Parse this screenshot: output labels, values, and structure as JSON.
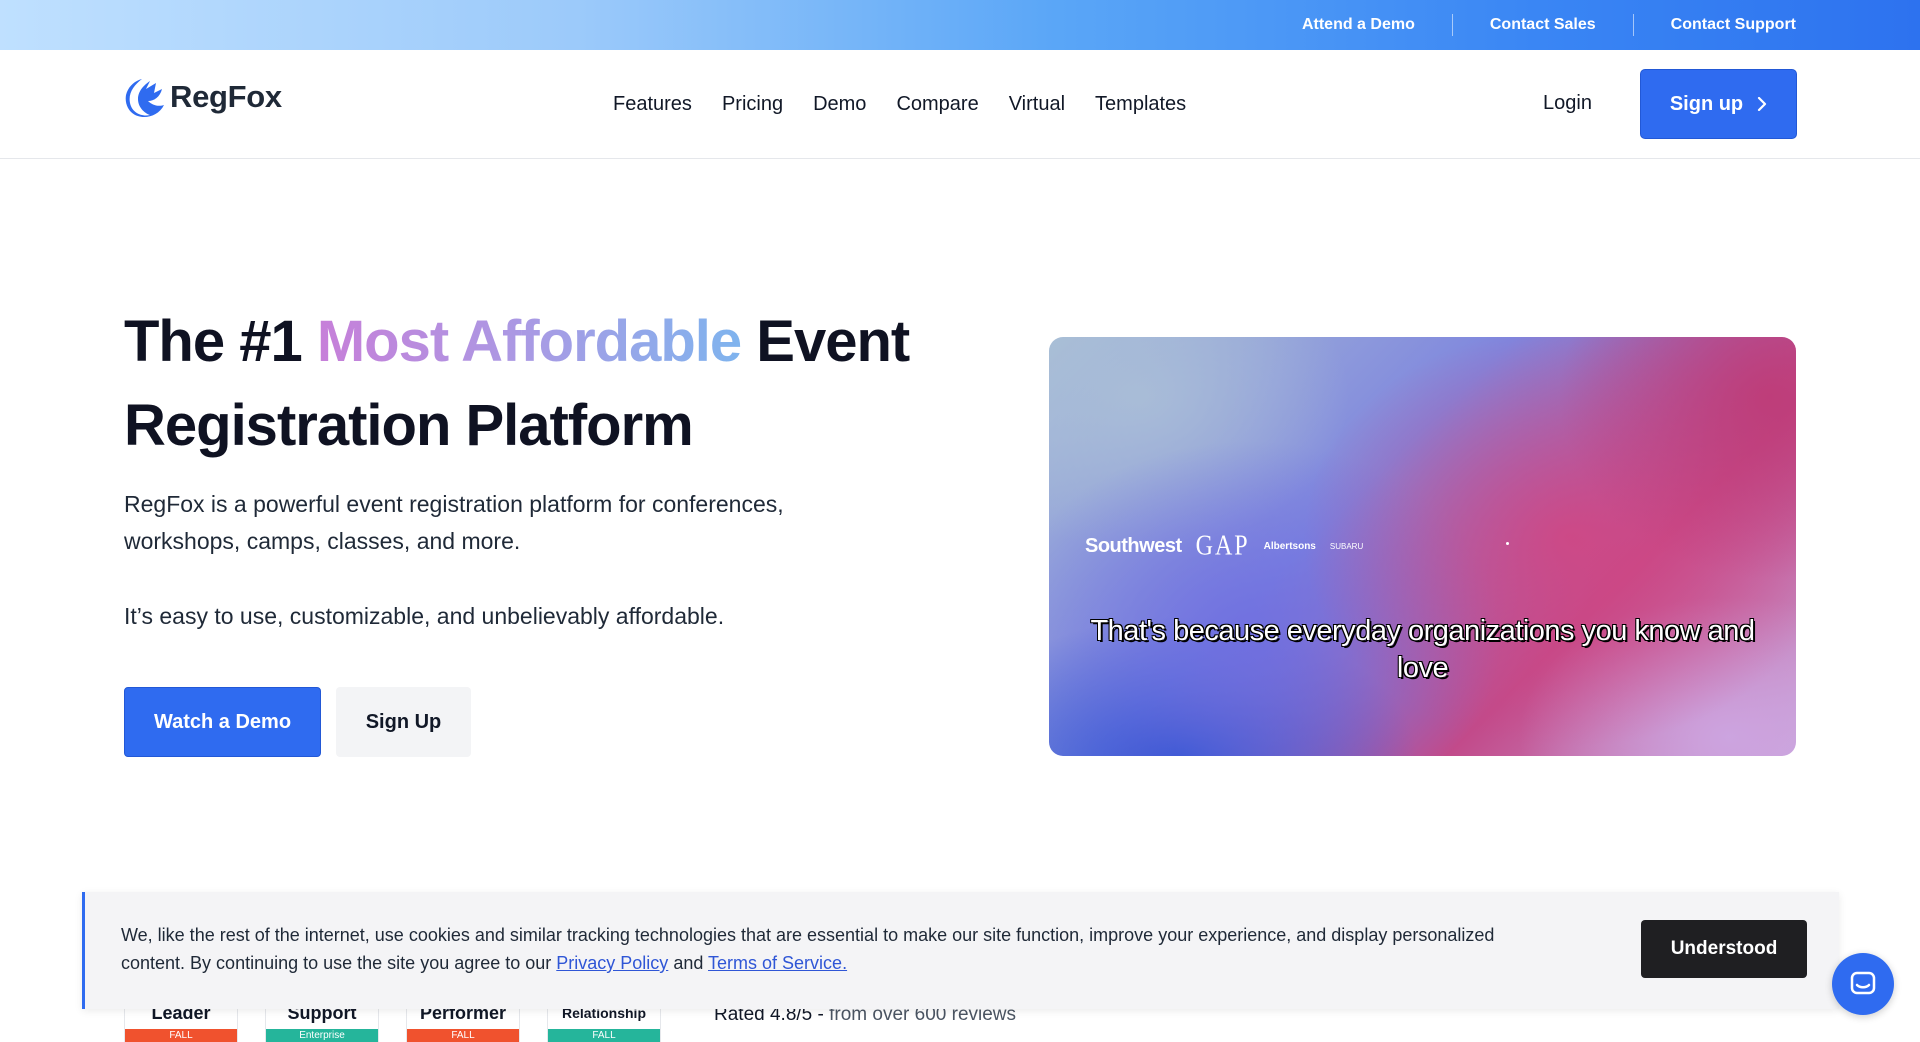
{
  "topbar": {
    "links": [
      "Attend a Demo",
      "Contact Sales",
      "Contact Support"
    ]
  },
  "nav": {
    "logo_text": "RegFox",
    "menu": [
      "Features",
      "Pricing",
      "Demo",
      "Compare",
      "Virtual",
      "Templates"
    ],
    "login": "Login",
    "signup": "Sign up"
  },
  "hero": {
    "title_pre": "The #1 ",
    "title_highlight": "Most Affordable",
    "title_post": " Event Registration Platform",
    "description": "RegFox is a powerful event registration platform for conferences, workshops, camps, classes, and more.",
    "description2": "It’s easy to use, customizable, and unbelievably affordable.",
    "primary_button": "Watch a Demo",
    "secondary_button": "Sign Up"
  },
  "video": {
    "logos": [
      "Southwest",
      "GAP",
      "Albertsons",
      "SUBARU"
    ],
    "caption": "That's because everyday organizations you know and love"
  },
  "cookie": {
    "text_pre": "We, like the rest of the internet, use cookies and similar tracking technologies that are essential to make our site function, improve your experience, and display personalized content. By continuing to use the site you agree to our ",
    "privacy_link": "Privacy Policy",
    "text_mid": " and ",
    "terms_link": "Terms of Service.",
    "button": "Understood"
  },
  "badges": [
    {
      "title": "Leader",
      "strip": "FALL"
    },
    {
      "title": "Support",
      "strip": "Enterprise"
    },
    {
      "title": "Performer",
      "strip": "FALL"
    },
    {
      "title": "Relationship",
      "strip": "FALL"
    }
  ],
  "rating": {
    "main": "Rated 4.8/5 - ",
    "sub": "from over 600 reviews"
  },
  "colors": {
    "primary": "#2f6bf0",
    "dark": "#1f1f22",
    "badge_red": "#f0522e",
    "badge_teal": "#25b59b"
  },
  "icons": [
    "regfox-logo-icon",
    "chevron-right-icon",
    "chat-icon"
  ]
}
